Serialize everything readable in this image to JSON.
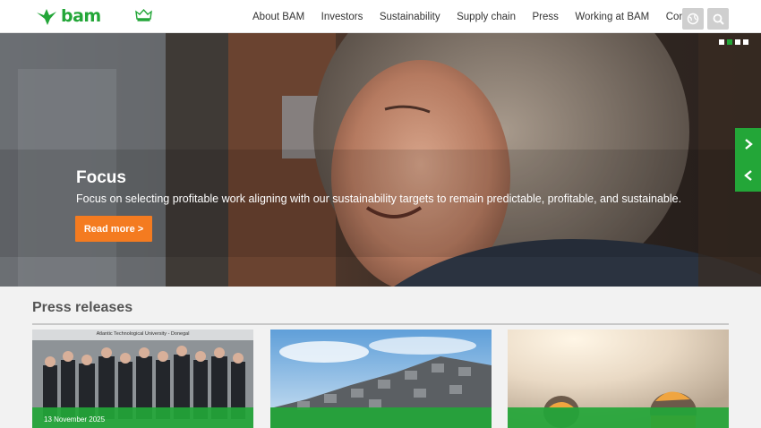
{
  "brand": {
    "name": "bam",
    "logo_icon": "bam-bird-logo-icon",
    "crown_icon": "royal-crown-icon",
    "accent_color": "#23a638",
    "cta_color": "#f47b20"
  },
  "nav": {
    "items": [
      {
        "label": "About BAM"
      },
      {
        "label": "Investors"
      },
      {
        "label": "Sustainability"
      },
      {
        "label": "Supply chain"
      },
      {
        "label": "Press"
      },
      {
        "label": "Working at BAM"
      },
      {
        "label": "Contact"
      }
    ],
    "language_icon": "globe-icon",
    "search_icon": "search-icon"
  },
  "hero": {
    "title": "Focus",
    "text": "Focus on selecting profitable work aligning with our sustainability targets to remain predictable, profitable, and sustainable.",
    "cta_label": "Read more >",
    "slides_total": 4,
    "active_slide": 2,
    "next_icon": "chevron-right-icon",
    "prev_icon": "chevron-left-icon"
  },
  "press": {
    "title": "Press releases",
    "cards": [
      {
        "date": "13 November 2025",
        "caption": "Atlantic Technological University - Donegal"
      },
      {
        "date": "",
        "caption": ""
      },
      {
        "date": "",
        "caption": ""
      }
    ]
  }
}
